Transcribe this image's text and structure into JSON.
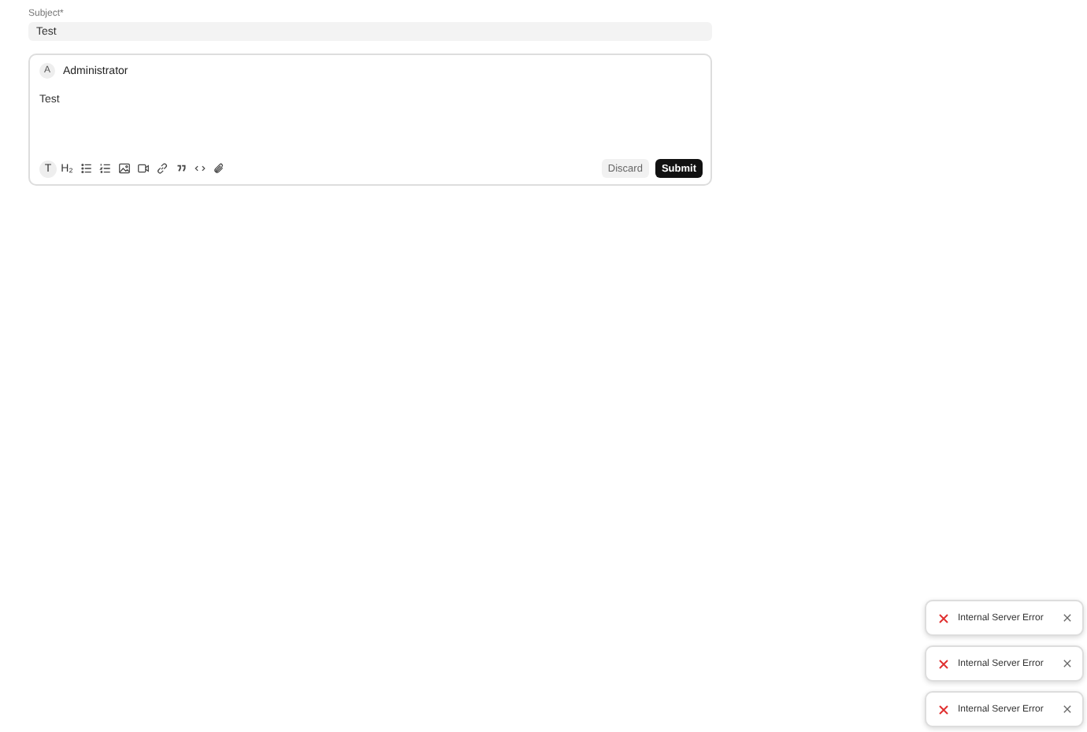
{
  "subject": {
    "label": "Subject*",
    "value": "Test"
  },
  "editor": {
    "avatar": "A",
    "author": "Administrator",
    "body": "Test",
    "tools": [
      {
        "kind": "text",
        "label": "T",
        "selected": true
      },
      {
        "kind": "text",
        "label": "H₂",
        "selected": false
      },
      {
        "kind": "bullet-list",
        "selected": false
      },
      {
        "kind": "numbered-list",
        "selected": false
      },
      {
        "kind": "image",
        "selected": false
      },
      {
        "kind": "video",
        "selected": false
      },
      {
        "kind": "link",
        "selected": false
      },
      {
        "kind": "quote",
        "selected": false
      },
      {
        "kind": "code",
        "selected": false
      },
      {
        "kind": "attachment",
        "selected": false
      }
    ],
    "buttons": [
      {
        "kind": "secondary",
        "label": "Discard"
      },
      {
        "kind": "primary",
        "label": "Submit"
      }
    ]
  },
  "toasts": [
    {
      "message": "Internal Server Error"
    },
    {
      "message": "Internal Server Error"
    },
    {
      "message": "Internal Server Error"
    }
  ]
}
